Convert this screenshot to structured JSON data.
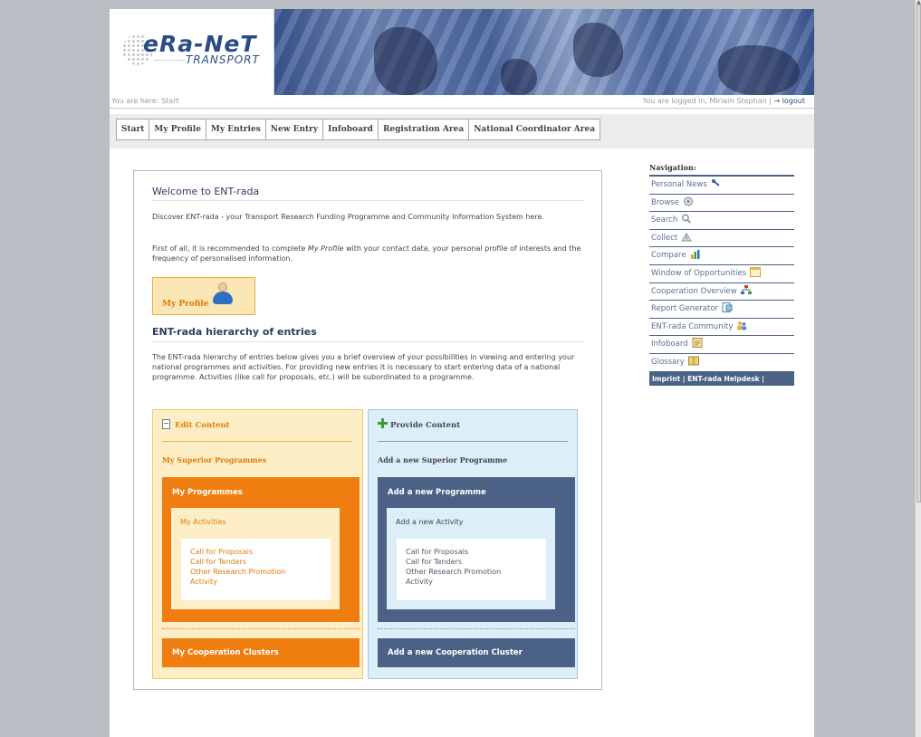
{
  "header": {
    "logo_main": "eRa-NeT",
    "logo_sub": "TRANSPORT"
  },
  "breadcrumb": {
    "you_are_here": "You are here: Start",
    "logged_in": "You are logged in, Miriam Stephan",
    "separator": "|",
    "logout": "logout"
  },
  "menu": {
    "items": [
      "Start",
      "My Profile",
      "My Entries",
      "New Entry",
      "Infoboard",
      "Registration Area",
      "National Coordinator Area"
    ]
  },
  "main": {
    "welcome_title": "Welcome to ENT-rada",
    "intro_1": "Discover ENT-rada - your Transport Research Funding Programme and Community Information System here.",
    "intro_2_pre": "First of all, it is recommended to complete ",
    "intro_2_em": "My Profile",
    "intro_2_post": " with your contact data, your personal profile of interests and the frequency of personalised information.",
    "profile_button": "My Profile",
    "hierarchy_title": "ENT-rada hierarchy of entries",
    "hierarchy_text": "The ENT-rada hierarchy of entries below gives you a brief overview of your possibilities in viewing and entering your national programmes and activities. For providing new entries it is necessary to start entering data of a national programme. Activities (like call for proposals, etc.) will be subordinated to a programme."
  },
  "edit_panel": {
    "title": "Edit Content",
    "superior": "My Superior Programmes",
    "programmes": "My Programmes",
    "activities": "My Activities",
    "items": [
      "Call for Proposals",
      "Call for Tenders",
      "Other Research Promotion",
      "Activity"
    ],
    "cluster": "My Cooperation Clusters"
  },
  "provide_panel": {
    "title": "Provide Content",
    "superior": "Add a new Superior Programme",
    "programmes": "Add a new Programme",
    "activities": "Add a new Activity",
    "items": [
      "Call for Proposals",
      "Call for Tenders",
      "Other Research Promotion",
      "Activity"
    ],
    "cluster": "Add a new Cooperation Cluster"
  },
  "navigation": {
    "heading": "Navigation:",
    "items": [
      {
        "label": "Personal News",
        "icon": "pin-icon"
      },
      {
        "label": "Browse",
        "icon": "browse-icon"
      },
      {
        "label": "Search",
        "icon": "magnifier-icon"
      },
      {
        "label": "Collect",
        "icon": "collect-icon"
      },
      {
        "label": "Compare",
        "icon": "bar-chart-icon"
      },
      {
        "label": "Window of Opportunities",
        "icon": "window-icon"
      },
      {
        "label": "Cooperation Overview",
        "icon": "org-chart-icon"
      },
      {
        "label": "Report Generator",
        "icon": "report-icon"
      },
      {
        "label": "ENT-rada Community",
        "icon": "community-icon"
      },
      {
        "label": "Infoboard",
        "icon": "board-icon"
      },
      {
        "label": "Glossary",
        "icon": "book-icon"
      }
    ],
    "footer": "Imprint | ENT-rada Helpdesk |"
  },
  "colors": {
    "accent_orange": "#ef7d0f",
    "accent_blue": "#4b6286",
    "title_blue": "#2b3e63"
  }
}
